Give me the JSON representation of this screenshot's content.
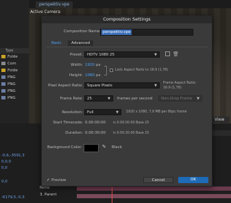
{
  "background": {
    "viewer_tab": "perspektiv.vpe",
    "viewer_label": "Active Camera",
    "project_column": "Type",
    "project_rows": [
      {
        "label": "Folde",
        "color": "#c9a227"
      },
      {
        "label": "Com",
        "color": "#8a8a8a"
      },
      {
        "label": "Folde",
        "color": "#c9a227"
      },
      {
        "label": "PNG",
        "color": "#6b7fa3"
      },
      {
        "label": "PNG",
        "color": "#6b7fa3"
      },
      {
        "label": "PNG",
        "color": "#6b7fa3"
      },
      {
        "label": "PNG",
        "color": "#6b7fa3"
      }
    ],
    "view_button": "View",
    "timeline_values": [
      "-0,6,-3591,3",
      "0,0,0",
      "0,0",
      "0,0",
      "-6179,5,-0,3"
    ],
    "timeline_none": "None",
    "timeline_parent": "3. Parent"
  },
  "dialog": {
    "title": "Composition Settings",
    "name_label": "Composition Name:",
    "name_value": "perspektiv.vpe",
    "tabs": [
      "Basic",
      "Advanced"
    ],
    "preset_label": "Preset:",
    "preset_value": "HDTV 1080 25",
    "width_label": "Width:",
    "width_value": "1920",
    "width_unit": "px",
    "height_label": "Height:",
    "height_value": "1080",
    "height_unit": "px",
    "lock_label": "Lock Aspect Ratio to 16:9 (1,78)",
    "par_label": "Pixel Aspect Ratio:",
    "par_value": "Square Pixels",
    "frame_aspect_label": "Frame Aspect Ratio:",
    "frame_aspect_value": "16:9 (1,78)",
    "framerate_label": "Frame Rate:",
    "framerate_value": "25",
    "framerate_unit": "frames per second",
    "dropframe_value": "Non-Drop Frame",
    "resolution_label": "Resolution:",
    "resolution_value": "Full",
    "resolution_info": "1920 x 1080, 7,9 MB per 8bpc frame",
    "start_label": "Start Timecode:",
    "start_value": "0:00:00:00",
    "start_info": "is 0:00:00:00  Base 25",
    "duration_label": "Duration:",
    "duration_value": "0:00:30:00",
    "duration_info": "is 0:00:30:00  Base 25",
    "bgcolor_label": "Background Color:",
    "bgcolor_name": "Black",
    "bgcolor_hex": "#000000",
    "preview_label": "Preview",
    "cancel_label": "Cancel",
    "ok_label": "OK"
  }
}
